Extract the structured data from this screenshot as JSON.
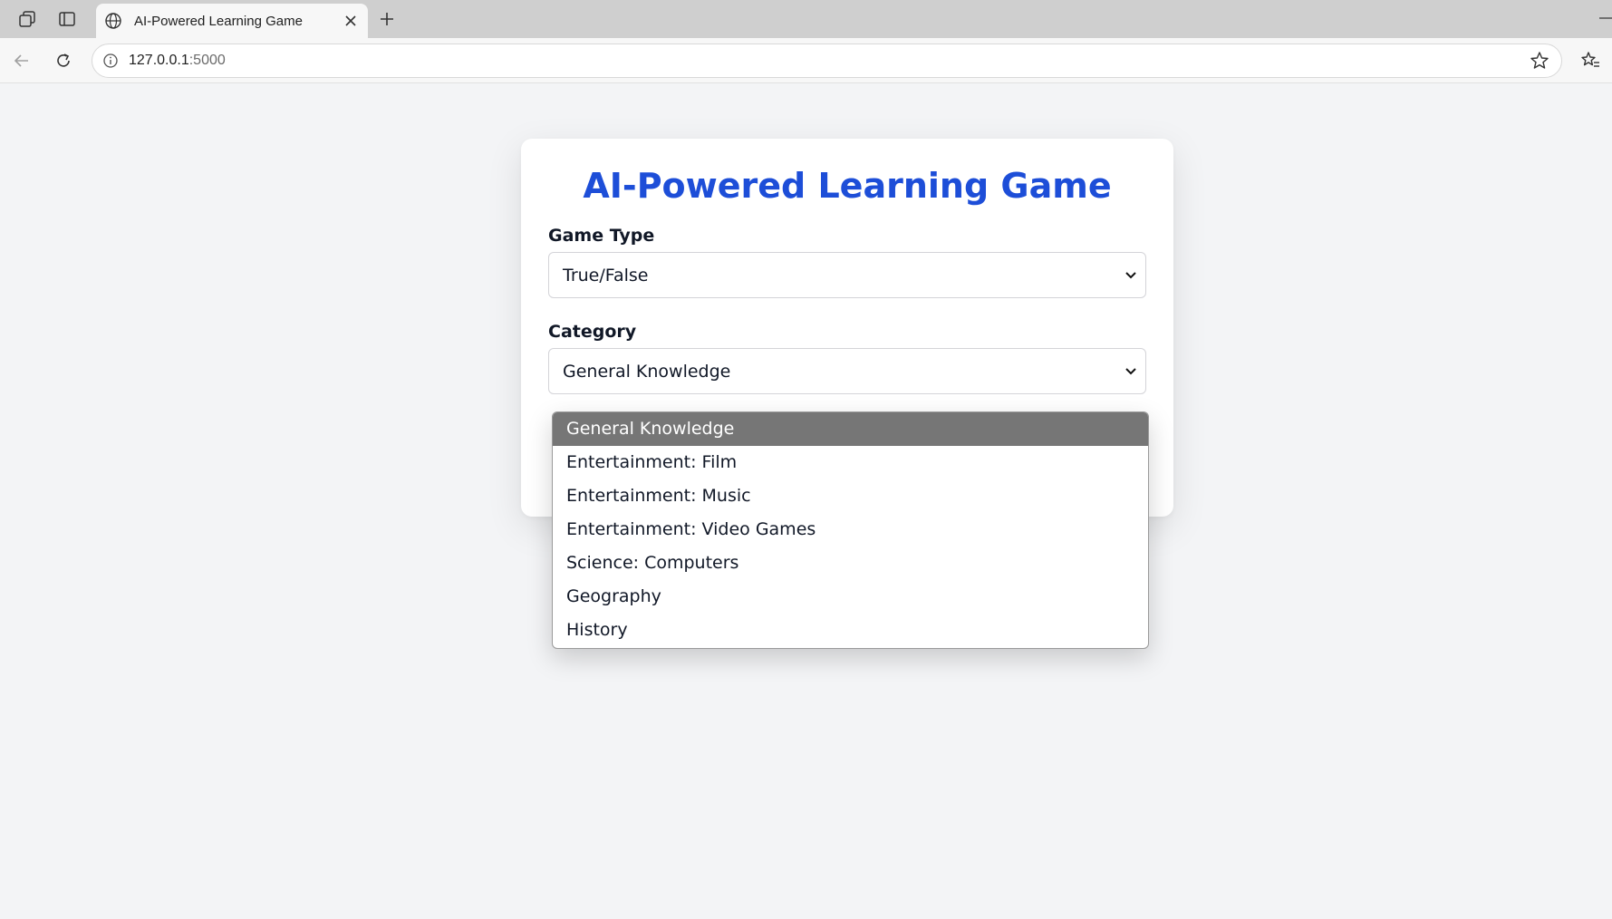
{
  "browser": {
    "tab_title": "AI-Powered Learning Game",
    "url_host": "127.0.0.1",
    "url_port": ":5000"
  },
  "page": {
    "heading": "AI-Powered Learning Game",
    "game_type": {
      "label": "Game Type",
      "value": "True/False"
    },
    "category": {
      "label": "Category",
      "value": "General Knowledge",
      "options": [
        "General Knowledge",
        "Entertainment: Film",
        "Entertainment: Music",
        "Entertainment: Video Games",
        "Science: Computers",
        "Geography",
        "History"
      ],
      "selected_index": 0
    }
  },
  "colors": {
    "heading": "#1d4ed8",
    "selected_option_bg": "#767676",
    "page_bg": "#f3f4f6"
  },
  "icons": {
    "workspaces": "workspaces-icon",
    "tab_actions": "tab-actions-icon",
    "globe": "globe-icon",
    "close": "close-icon",
    "new_tab": "plus-icon",
    "back": "back-arrow-icon",
    "reload": "reload-icon",
    "info": "info-icon",
    "star": "star-icon",
    "favorites": "favorites-icon",
    "chevron": "chevron-down-icon"
  }
}
